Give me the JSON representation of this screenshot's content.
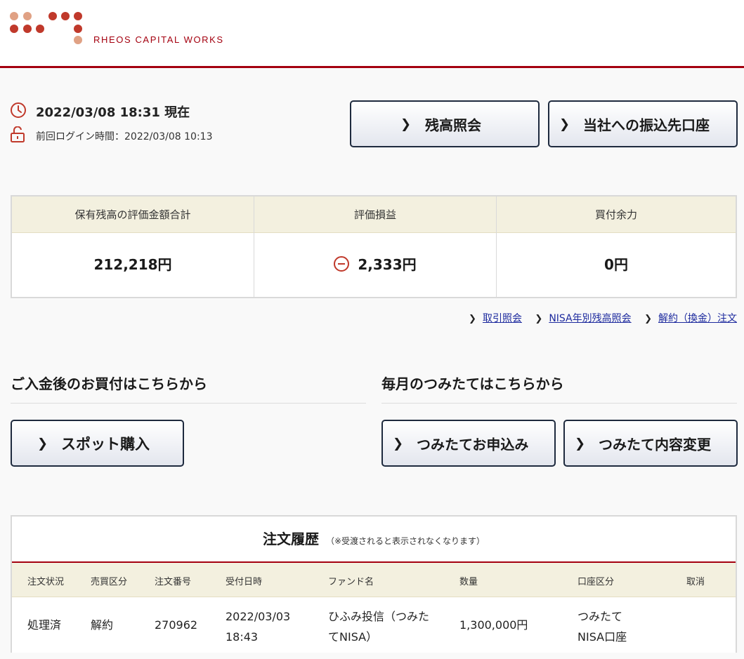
{
  "brand": {
    "name": "RHEOS CAPITAL WORKS",
    "colors": {
      "primary": "#a4000f",
      "accent_dot": "#c0392b",
      "soft_dot": "#e0a184",
      "link": "#1d2a9e"
    }
  },
  "status": {
    "now": "2022/03/08 18:31 現在",
    "last_login": "前回ログイン時間：2022/03/08 10:13"
  },
  "top_buttons": {
    "balance": "残高照会",
    "transfer": "当社への振込先口座"
  },
  "summary": {
    "headers": [
      "保有残高の評価金額合計",
      "評価損益",
      "買付余力"
    ],
    "total_value": "212,218円",
    "profit_loss": "2,333円",
    "buying_power": "0円"
  },
  "links": {
    "transactions": "取引照会",
    "nisa": "NISA年別残高照会",
    "cancel": "解約（換金）注文"
  },
  "purchase": {
    "title": "ご入金後のお買付はこちらから",
    "spot_button": "スポット購入"
  },
  "tsumitate": {
    "title": "毎月のつみたてはこちらから",
    "apply_button": "つみたてお申込み",
    "change_button": "つみたて内容変更"
  },
  "orders": {
    "title": "注文履歴",
    "note": "（※受渡されると表示されなくなります）",
    "columns": [
      "注文状況",
      "売買区分",
      "注文番号",
      "受付日時",
      "ファンド名",
      "数量",
      "口座区分",
      "取消"
    ],
    "rows": [
      {
        "status": "処理済",
        "type": "解約",
        "number": "270962",
        "date": "2022/03/03",
        "time": "18:43",
        "fund_line1": "ひふみ投信（つみた",
        "fund_line2": "てNISA）",
        "quantity": "1,300,000円",
        "account_line1": "つみたて",
        "account_line2": "NISA口座",
        "cancel": ""
      }
    ]
  }
}
